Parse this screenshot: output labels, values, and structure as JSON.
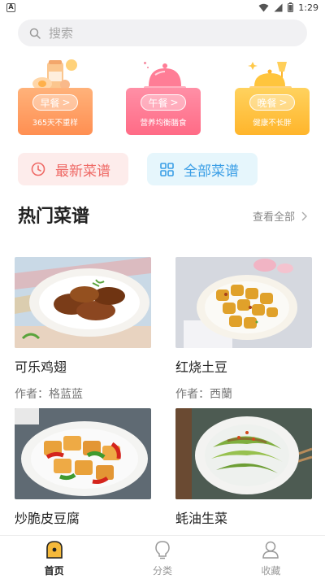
{
  "status_bar": {
    "time": "1:29"
  },
  "search": {
    "placeholder": "搜索"
  },
  "meals": [
    {
      "label": "早餐",
      "subtitle": "365天不重样",
      "arrow": ">"
    },
    {
      "label": "午餐",
      "subtitle": "营养均衡膳食",
      "arrow": ">"
    },
    {
      "label": "晚餐",
      "subtitle": "健康不长胖",
      "arrow": ">"
    }
  ],
  "quick_buttons": {
    "latest": "最新菜谱",
    "all": "全部菜谱"
  },
  "section": {
    "title": "热门菜谱",
    "more": "查看全部"
  },
  "recipes": [
    {
      "name": "可乐鸡翅",
      "author": "作者：格蓝蓝"
    },
    {
      "name": "红烧土豆",
      "author": "作者：西蘭"
    },
    {
      "name": "炒脆皮豆腐",
      "author": ""
    },
    {
      "name": "蚝油生菜",
      "author": ""
    }
  ],
  "bottom_nav": {
    "home": "首页",
    "category": "分类",
    "favorites": "收藏"
  },
  "colors": {
    "breakfast": "#ff8f52",
    "lunch": "#ff6b86",
    "dinner": "#ffb52b",
    "latest_text": "#ef6a66",
    "all_text": "#3a9ee6",
    "home_icon": "#f5b93a"
  },
  "icons": [
    "search-icon",
    "clock-icon",
    "grid-icon",
    "chevron-right-icon",
    "home-icon",
    "bulb-icon",
    "user-icon",
    "wifi-icon",
    "signal-icon",
    "battery-icon"
  ]
}
